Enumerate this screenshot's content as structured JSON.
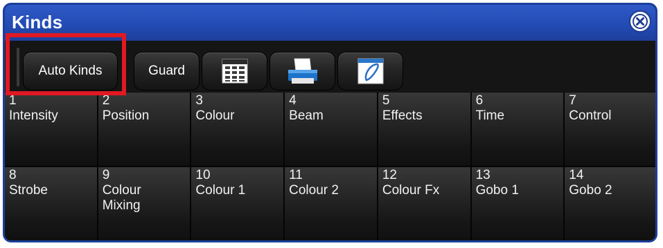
{
  "window": {
    "title": "Kinds"
  },
  "toolbar": {
    "auto_kinds_label": "Auto Kinds",
    "guard_label": "Guard"
  },
  "kinds": [
    {
      "number": "1",
      "label": "Intensity"
    },
    {
      "number": "2",
      "label": "Position"
    },
    {
      "number": "3",
      "label": "Colour"
    },
    {
      "number": "4",
      "label": "Beam"
    },
    {
      "number": "5",
      "label": "Effects"
    },
    {
      "number": "6",
      "label": "Time"
    },
    {
      "number": "7",
      "label": "Control"
    },
    {
      "number": "8",
      "label": "Strobe"
    },
    {
      "number": "9",
      "label": "Colour\nMixing"
    },
    {
      "number": "10",
      "label": "Colour 1"
    },
    {
      "number": "11",
      "label": "Colour 2"
    },
    {
      "number": "12",
      "label": "Colour Fx"
    },
    {
      "number": "13",
      "label": "Gobo 1"
    },
    {
      "number": "14",
      "label": "Gobo 2"
    }
  ],
  "icons": {
    "close": "close-icon",
    "spreadsheet": "spreadsheet-icon",
    "print": "print-icon",
    "window": "window-icon"
  },
  "colors": {
    "titlebar": "#234cb5",
    "highlight": "#e01922",
    "background": "#101010"
  }
}
